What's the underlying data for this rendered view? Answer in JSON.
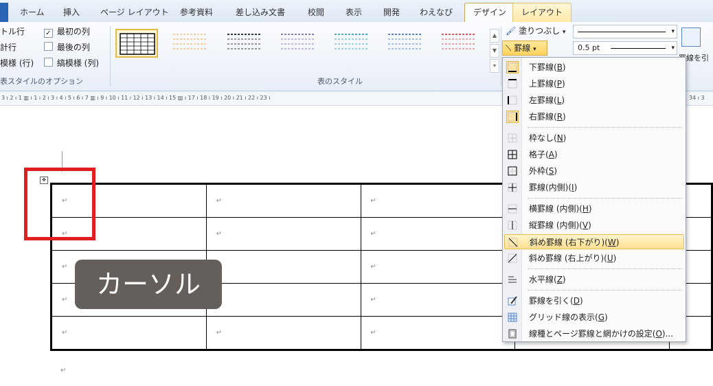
{
  "tabs": [
    {
      "label": "ホーム"
    },
    {
      "label": "挿入"
    },
    {
      "label": "ページ レイアウト"
    },
    {
      "label": "参考資料"
    },
    {
      "label": "差し込み文書"
    },
    {
      "label": "校閲"
    },
    {
      "label": "表示"
    },
    {
      "label": "開発"
    },
    {
      "label": "わえなび"
    },
    {
      "label": "デザイン"
    },
    {
      "label": "レイアウト"
    }
  ],
  "style_options": {
    "rows": [
      {
        "left": "トル行",
        "right_checked": true,
        "right": "最初の列"
      },
      {
        "left": "計行",
        "right_checked": false,
        "right": "最後の列"
      },
      {
        "left": "模様 (行)",
        "right_checked": false,
        "right": "縞模様 (列)"
      }
    ],
    "group_label": "表スタイルのオプション"
  },
  "table_styles": {
    "group_label": "表のスタイル",
    "thumb_colors": [
      "#000000",
      "#f0a44a",
      "#333333",
      "#8a7bbf",
      "#4aa8c8",
      "#5a86c8",
      "#d55b5b"
    ]
  },
  "draw": {
    "shading_label": "塗りつぶし",
    "borders_label": "罫線",
    "pen_weight": "0.5 pt",
    "draw_table_label": "罫線を引く"
  },
  "ruler": {
    "text": "3 ı 2 ı 1 ▥  ı 1 ı 2 ı 3 ı 4 ı 5 ı 6 ı 7 ▥ ı 9 ı 10 ı 11 ı 12 ı 13 ı 14 ı 15 ▥ ı 17 ı 18 ı 19 ı 20 ı 21 ı 22 ı 23 ı",
    "right_text": "34 ı 3"
  },
  "document": {
    "cell_mark": "↵",
    "badge_text": "カーソル"
  },
  "menu": {
    "items": [
      {
        "label": "下罫線",
        "key": "B",
        "icon": "bottom-border-icon",
        "sel": true
      },
      {
        "label": "上罫線",
        "key": "P",
        "icon": "top-border-icon"
      },
      {
        "label": "左罫線",
        "key": "L",
        "icon": "left-border-icon"
      },
      {
        "label": "右罫線",
        "key": "R",
        "icon": "right-border-icon",
        "sel": true
      },
      {
        "label": "枠なし",
        "key": "N",
        "icon": "no-border-icon"
      },
      {
        "label": "格子",
        "key": "A",
        "icon": "all-borders-icon"
      },
      {
        "label": "外枠",
        "key": "S",
        "icon": "outside-borders-icon"
      },
      {
        "label": "罫線(内側)",
        "key": "I",
        "icon": "inside-borders-icon"
      },
      {
        "label": "横罫線 (内側)",
        "key": "H",
        "icon": "inside-horizontal-border-icon"
      },
      {
        "label": "縦罫線 (内側)",
        "key": "V",
        "icon": "inside-vertical-border-icon"
      },
      {
        "label": "斜め罫線 (右下がり)",
        "key": "W",
        "icon": "diagonal-down-border-icon",
        "hover": true
      },
      {
        "label": "斜め罫線 (右上がり)",
        "key": "U",
        "icon": "diagonal-up-border-icon"
      },
      {
        "label": "水平線",
        "key": "Z",
        "icon": "horizontal-line-icon"
      },
      {
        "label": "罫線を引く",
        "key": "D",
        "icon": "draw-table-icon"
      },
      {
        "label": "グリッド線の表示",
        "key": "G",
        "icon": "view-gridlines-icon"
      },
      {
        "label": "線種とページ罫線と網かけの設定",
        "key": "O",
        "suffix": "...",
        "icon": "borders-shading-icon"
      }
    ]
  }
}
